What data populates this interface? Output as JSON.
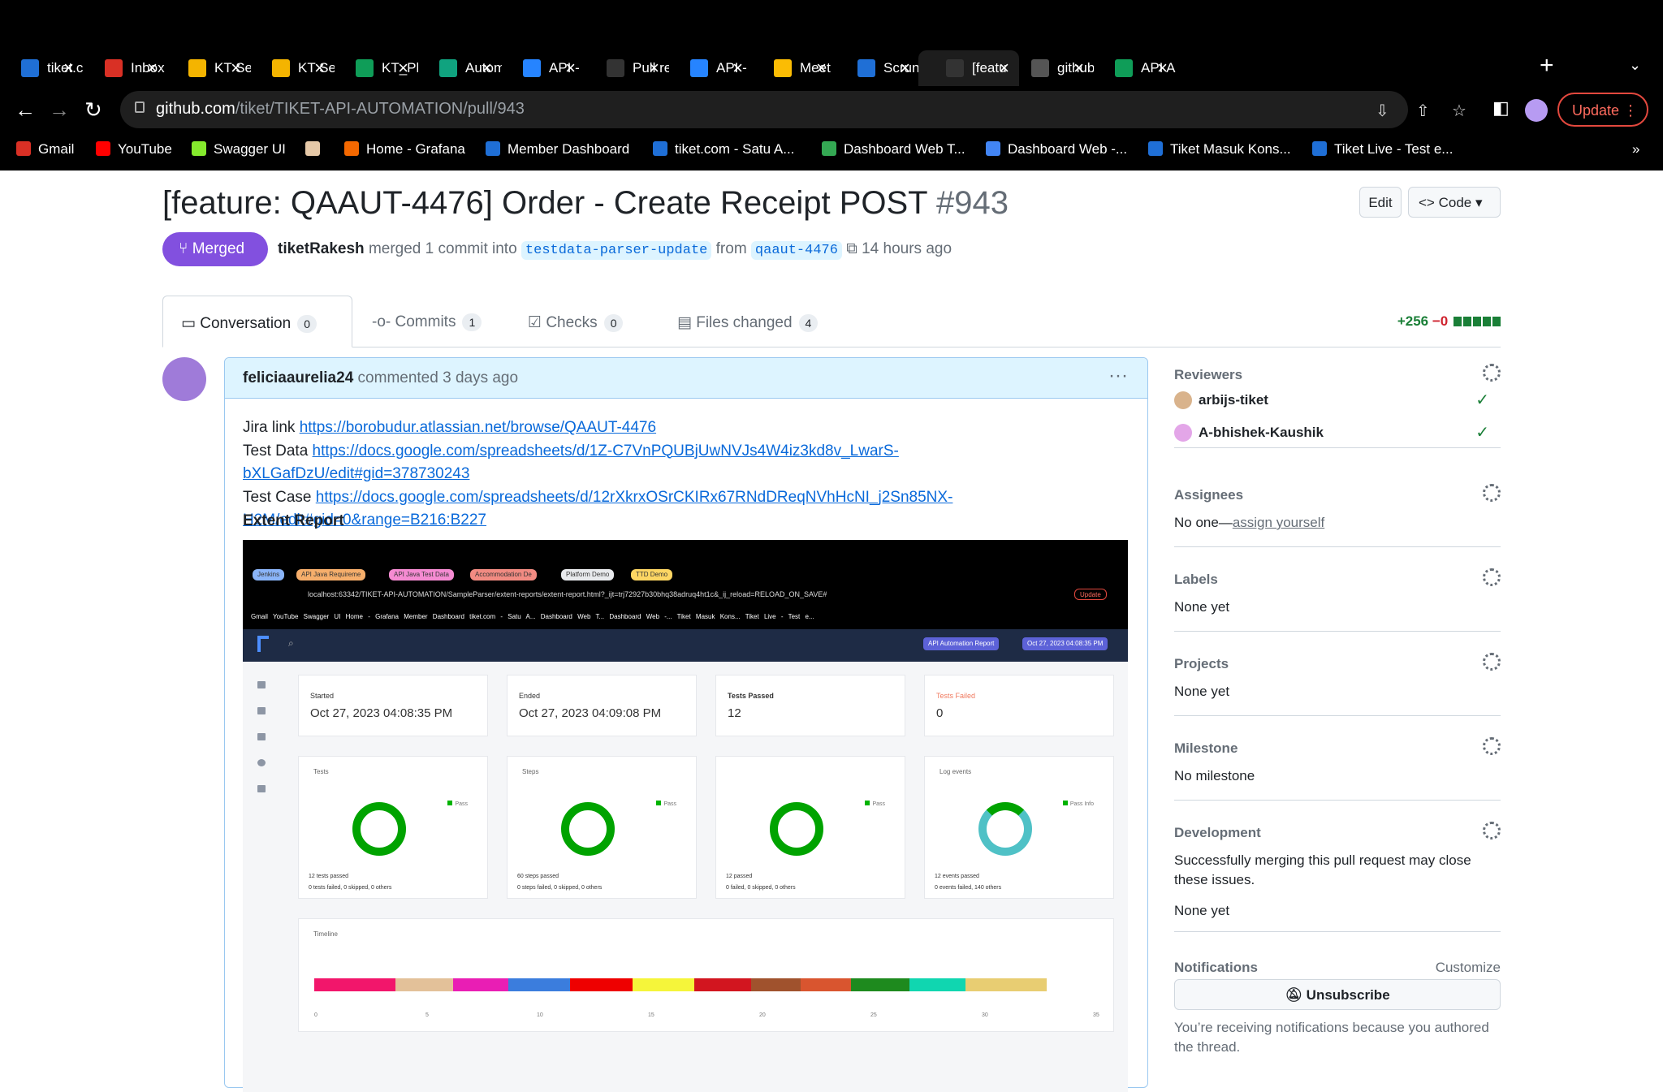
{
  "browser": {
    "tabs": [
      {
        "label": "tiket.c",
        "fav": "#1f6fd6"
      },
      {
        "label": "Inbox",
        "fav": "#d93025"
      },
      {
        "label": "KT Se",
        "fav": "#f4b400"
      },
      {
        "label": "KT Se",
        "fav": "#f4b400"
      },
      {
        "label": "KT_Pl",
        "fav": "#0f9d58"
      },
      {
        "label": "Autom",
        "fav": "#10a37f"
      },
      {
        "label": "API -",
        "fav": "#2684ff"
      },
      {
        "label": "Pull re",
        "fav": "#333333"
      },
      {
        "label": "API -",
        "fav": "#2684ff"
      },
      {
        "label": "Meet",
        "fav": "#fbbc04"
      },
      {
        "label": "Scrun",
        "fav": "#1f6fd6"
      },
      {
        "label": "[featu",
        "fav": "#333333"
      },
      {
        "label": "github",
        "fav": "#555555"
      },
      {
        "label": "API A",
        "fav": "#0f9d58"
      }
    ],
    "url_host": "github.com",
    "url_path": "/tiket/TIKET-API-AUTOMATION/pull/943",
    "update_label": "Update",
    "bookmarks": [
      "Gmail",
      "YouTube",
      "Swagger UI",
      "",
      "Home - Grafana",
      "Member Dashboard",
      "tiket.com - Satu A...",
      "Dashboard Web T...",
      "Dashboard Web -...",
      "Tiket Masuk Kons...",
      "Tiket Live - Test e..."
    ],
    "bookmarks_more": "»"
  },
  "pr": {
    "title": "[feature: QAAUT-4476] Order - Create Receipt POST",
    "number": "#943",
    "edit_label": "Edit",
    "code_label": "Code",
    "status": "Merged",
    "author": "tiketRakesh",
    "merged_text": "merged 1 commit into",
    "base_branch": "testdata-parser-update",
    "from_text": "from",
    "head_branch": "qaaut-4476",
    "time": "14 hours ago",
    "tabs": [
      {
        "label": "Conversation",
        "count": "0"
      },
      {
        "label": "Commits",
        "count": "1"
      },
      {
        "label": "Checks",
        "count": "0"
      },
      {
        "label": "Files changed",
        "count": "4"
      }
    ],
    "additions": "+256",
    "deletions": "−0"
  },
  "comment": {
    "author": "feliciaaurelia24",
    "meta": "commented 3 days ago",
    "jira_label": "Jira link",
    "jira_url": "https://borobudur.atlassian.net/browse/QAAUT-4476",
    "testdata_label": "Test Data",
    "testdata_url_1": "https://docs.google.com/spreadsheets/d/1Z-C7VnPQUBjUwNVJs4W4iz3kd8v_LwarS-",
    "testdata_url_2": "bXLGafDzU/edit#gid=378730243",
    "testcase_label": "Test Case",
    "testcase_url_1": "https://docs.google.com/spreadsheets/d/12rXkrxOSrCKIRx67RNdDReqNVhHcNI_j2Sn85NX-",
    "testcase_url_2": "H2M/edit#gid=0&range=B216:B227",
    "heading": "Extent Report"
  },
  "report": {
    "pills": [
      "Jenkins",
      "API Java Requireme",
      "API Java Test Data",
      "Accommodation De",
      "Platform Demo",
      "TTD Demo"
    ],
    "url": "localhost:63342/TIKET-API-AUTOMATION/SampleParser/extent-reports/extent-report.html?_ijt=trj72927b30bhq38adruq4ht1c&_ij_reload=RELOAD_ON_SAVE#",
    "mini_update": "Update",
    "bookmarks": "Gmail YouTube Swagger UI Home - Grafana Member Dashboard tiket.com - Satu A... Dashboard Web T... Dashboard Web -... Tiket Masuk Kons... Tiket Live - Test e...",
    "badge1": "API Automation Report",
    "badge2": "Oct 27, 2023 04:08:35 PM",
    "started_label": "Started",
    "started": "Oct 27, 2023 04:08:35 PM",
    "ended_label": "Ended",
    "ended": "Oct 27, 2023 04:09:08 PM",
    "passed_label": "Tests Passed",
    "passed": "12",
    "failed_label": "Tests Failed",
    "failed": "0",
    "charts": [
      {
        "title": "Tests",
        "legend": "Pass",
        "foot1": "12 tests passed",
        "foot2": "0 tests failed, 0 skipped, 0 others"
      },
      {
        "title": "Steps",
        "legend": "Pass",
        "foot1": "60 steps passed",
        "foot2": "0 steps failed, 0 skipped, 0 others"
      },
      {
        "title": "",
        "legend": "Pass",
        "foot1": "12 passed",
        "foot2": "0 failed, 0 skipped, 0 others"
      },
      {
        "title": "Log events",
        "legend": "Pass Info",
        "foot1": "12 events passed",
        "foot2": "0 events failed, 140 others"
      }
    ],
    "timeline_title": "Timeline",
    "timeline_ticks": [
      "0",
      "5",
      "10",
      "15",
      "20",
      "25",
      "30",
      "35"
    ],
    "timeline_colors": [
      "#f2166b",
      "#e3c199",
      "#e91eb4",
      "#3b7ddd",
      "#ee0000",
      "#f5f53a",
      "#d2151f",
      "#a0522d",
      "#d9552f",
      "#1e8a1e",
      "#10d6b0",
      "#e8cd72"
    ]
  },
  "sidebar": {
    "reviewers_label": "Reviewers",
    "reviewers": [
      "arbijs-tiket",
      "A-bhishek-Kaushik"
    ],
    "assignees_label": "Assignees",
    "assignees_text": "No one—",
    "assign_link": "assign yourself",
    "labels_label": "Labels",
    "labels_value": "None yet",
    "projects_label": "Projects",
    "projects_value": "None yet",
    "milestone_label": "Milestone",
    "milestone_value": "No milestone",
    "development_label": "Development",
    "development_text_1": "Successfully merging this pull request may close",
    "development_text_2": "these issues.",
    "development_value": "None yet",
    "notifications_label": "Notifications",
    "customize_label": "Customize",
    "unsubscribe_label": "Unsubscribe",
    "notif_note_1": "You’re receiving notifications because you authored",
    "notif_note_2": "the thread."
  }
}
